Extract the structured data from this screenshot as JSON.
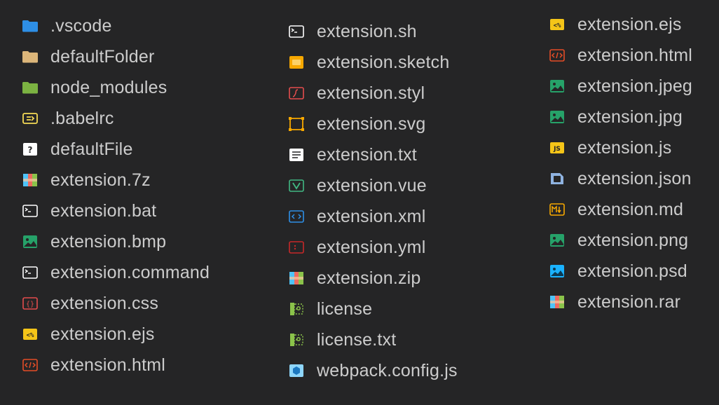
{
  "colors": {
    "background": "#252526",
    "text": "#cccccc"
  },
  "columns": [
    {
      "items": [
        {
          "label": ".vscode",
          "icon": "folder-vscode-icon",
          "color": "#2e8fe6"
        },
        {
          "label": "defaultFolder",
          "icon": "folder-icon",
          "color": "#dcb67a"
        },
        {
          "label": "node_modules",
          "icon": "folder-node-icon",
          "color": "#7cb342"
        },
        {
          "label": ".babelrc",
          "icon": "babel-icon",
          "color": "#f5da55"
        },
        {
          "label": "defaultFile",
          "icon": "default-file-icon",
          "color": "#ffffff"
        },
        {
          "label": "extension.7z",
          "icon": "archive-icon",
          "color": "#ee6a5f"
        },
        {
          "label": "extension.bat",
          "icon": "terminal-icon",
          "color": "#ffffff"
        },
        {
          "label": "extension.bmp",
          "icon": "image-icon",
          "color": "#26a269"
        },
        {
          "label": "extension.command",
          "icon": "terminal-icon",
          "color": "#ffffff"
        },
        {
          "label": "extension.css",
          "icon": "css-icon",
          "color": "#e44d4d"
        },
        {
          "label": "extension.ejs",
          "icon": "ejs-icon",
          "color": "#f5c518"
        },
        {
          "label": "extension.html",
          "icon": "html-icon",
          "color": "#e44d26"
        }
      ]
    },
    {
      "items": [
        {
          "label": "extension.sh",
          "icon": "terminal-icon",
          "color": "#ffffff"
        },
        {
          "label": "extension.sketch",
          "icon": "sketch-icon",
          "color": "#f7a800"
        },
        {
          "label": "extension.styl",
          "icon": "stylus-icon",
          "color": "#e44d4d"
        },
        {
          "label": "extension.svg",
          "icon": "svg-icon",
          "color": "#f7a800"
        },
        {
          "label": "extension.txt",
          "icon": "text-file-icon",
          "color": "#ffffff"
        },
        {
          "label": "extension.vue",
          "icon": "vue-icon",
          "color": "#41b883"
        },
        {
          "label": "extension.xml",
          "icon": "xml-icon",
          "color": "#2e8fe6"
        },
        {
          "label": "extension.yml",
          "icon": "yaml-icon",
          "color": "#c62828"
        },
        {
          "label": "extension.zip",
          "icon": "archive-icon",
          "color": "#ee6a5f"
        },
        {
          "label": "license",
          "icon": "license-icon",
          "color": "#8bc34a"
        },
        {
          "label": "license.txt",
          "icon": "license-icon",
          "color": "#8bc34a"
        },
        {
          "label": "webpack.config.js",
          "icon": "webpack-icon",
          "color": "#8ed6fb"
        }
      ]
    },
    {
      "items": [
        {
          "label": "extension.ejs",
          "icon": "ejs-icon",
          "color": "#f5c518"
        },
        {
          "label": "extension.html",
          "icon": "html-icon",
          "color": "#e44d26"
        },
        {
          "label": "extension.jpeg",
          "icon": "image-icon",
          "color": "#26a269"
        },
        {
          "label": "extension.jpg",
          "icon": "image-icon",
          "color": "#26a269"
        },
        {
          "label": "extension.js",
          "icon": "js-icon",
          "color": "#f5c518"
        },
        {
          "label": "extension.json",
          "icon": "json-icon",
          "color": "#8fb3e0"
        },
        {
          "label": "extension.md",
          "icon": "markdown-icon",
          "color": "#f7a800"
        },
        {
          "label": "extension.png",
          "icon": "image-icon",
          "color": "#26a269"
        },
        {
          "label": "extension.psd",
          "icon": "psd-icon",
          "color": "#1ab2ff"
        },
        {
          "label": "extension.rar",
          "icon": "archive-icon",
          "color": "#ee6a5f"
        }
      ]
    }
  ]
}
